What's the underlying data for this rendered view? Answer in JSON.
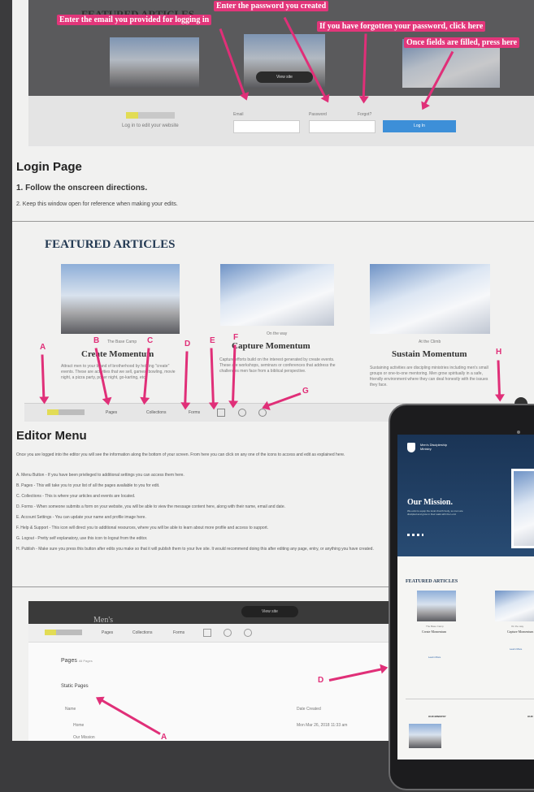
{
  "top": {
    "featured": "FEATURED ARTICLES",
    "callouts": {
      "email": "Enter the email you provided for logging in",
      "password": "Enter the password you created",
      "forgot": "If you have forgotten your password, click here",
      "submit": "Once fields are filled, press here"
    },
    "login_caption": "Log in to edit your website",
    "email_label": "Email",
    "password_label": "Password",
    "forgot_link": "Forgot?",
    "login_button": "Log In",
    "view_site": "View site"
  },
  "login": {
    "heading": "Login Page",
    "step1": "1. Follow the onscreen directions.",
    "step2": "2. Keep this window open for reference when making your edits."
  },
  "featured": {
    "title": "FEATURED ARTICLES",
    "cards": [
      {
        "caption": "The Base Camp",
        "title": "Create Momentum",
        "text": "Attract men to your brand of brotherhood by holding \"create\" events. These are activities that we sell, games, bowling, movie night, a pizza party, poker night, go-karting, etc."
      },
      {
        "caption": "On the way",
        "title": "Capture Momentum",
        "text": "Capture efforts build on the interest generated by create events. These are workshops, seminars or conferences that address the challenges men face from a biblical perspective."
      },
      {
        "caption": "At the Climb",
        "title": "Sustain Momentum",
        "text": "Sustaining activities are discipling ministries including men's small groups or one-to-one mentoring. Men grow spiritually in a safe, friendly environment where they can deal honestly with the issues they face."
      }
    ]
  },
  "letters": {
    "a": "A",
    "b": "B",
    "c": "C",
    "d": "D",
    "e": "E",
    "f": "F",
    "g": "G",
    "h": "H"
  },
  "toolbar": {
    "pages": "Pages",
    "collections": "Collections",
    "forms": "Forms"
  },
  "editor": {
    "heading": "Editor Menu",
    "intro": "Once you are logged into the editor you will see the information along the bottom of your screen. From here you can click on any one of the icons to access and edit as explained here.",
    "items": [
      "A. Menu Button - If you have been privileged to additional settings you can access them here.",
      "B. Pages - This will take you to your list of all the pages available to you for edit.",
      "C. Collections - This is where your articles and events are located.",
      "D. Forms - When someone submits a form on your website, you will be able to view the message content here, along with their name, email and date.",
      "E. Account Settings - You can update your name and profile image here.",
      "F. Help & Support - This icon will direct you to additional resources, where you will be able to learn about more profile and access to support.",
      "G. Logout - Pretty self explanatory, use this icon to logout from the editor.",
      "H. Publish - Make sure you press this button after edits you make so that it will publish them to your live site. It would recommend doing this after editing any page, entry, or anything you have created."
    ]
  },
  "bottom": {
    "site_name": "Men's",
    "view_site": "View site",
    "tabs": [
      "Pages",
      "Collections",
      "Forms"
    ],
    "crumb": "Pages",
    "crumb_sub": "All Pages",
    "static_pages": "Static Pages",
    "col_name": "Name",
    "col_updated": "Date Created",
    "rows": [
      {
        "name": "Home",
        "date": "Mon Mar 26, 2018 11:33 am"
      },
      {
        "name": "Our Mission",
        "date": ""
      }
    ]
  },
  "tablet": {
    "brand": "Men's Discipleship Ministry",
    "hero_title": "Our Mission.",
    "hero_text": "We exist to equip the local church body, so men are discipled and grow in their walk with the Lord.",
    "featured": "FEATURED ARTICLES",
    "card1_caption": "The Base Camp",
    "card1_title": "Create Momentum",
    "card2_caption": "On the way",
    "card2_title": "Capture Momentum",
    "learn_more": "Learn More",
    "section1": "OUR MINISTRY",
    "section2": "OUR"
  }
}
